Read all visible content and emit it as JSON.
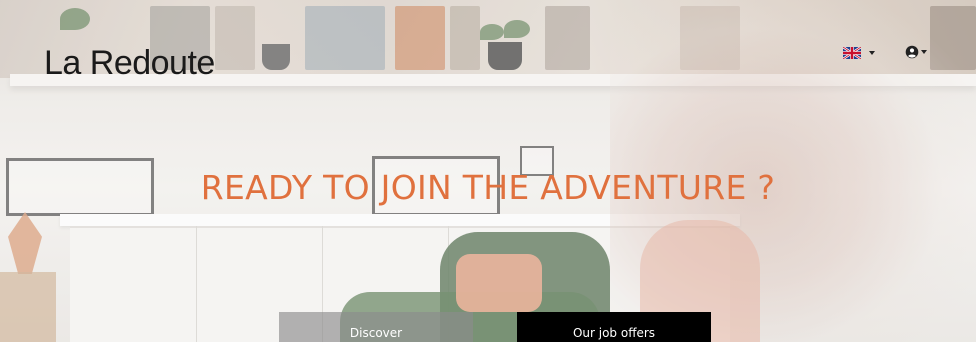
{
  "header": {
    "logo_text": "La Redoute",
    "language_icon": "uk-flag-icon",
    "user_icon": "user-circle-icon"
  },
  "hero": {
    "headline": "READY TO JOIN THE ADVENTURE ?"
  },
  "actions": {
    "discover_label": "Discover",
    "jobs_label": "Our job offers"
  },
  "colors": {
    "headline": "#e0713e",
    "jobs_button_bg": "#000000",
    "discover_button_bg": "#8c8c8c"
  }
}
